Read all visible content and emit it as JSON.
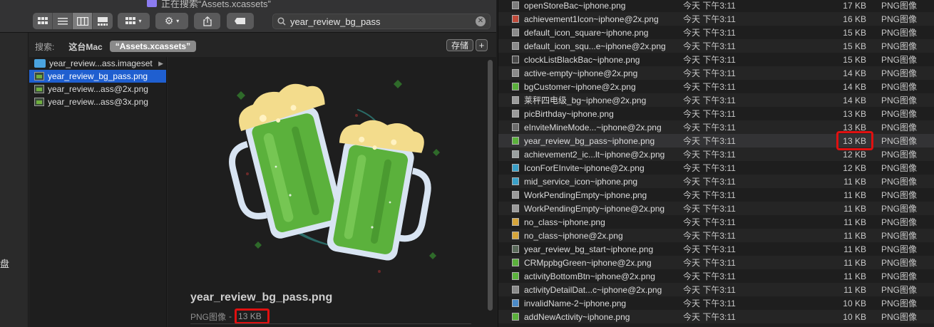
{
  "window_title": "正在搜索“Assets.xcassets”",
  "sidebar_partial_char": "盘",
  "search": {
    "value": "year_review_bg_pass"
  },
  "scope": {
    "label": "搜索:",
    "this_mac": "这台Mac",
    "folder": "“Assets.xcassets”",
    "save": "存储",
    "add": "+"
  },
  "results": [
    {
      "name": "year_review...ass.imageset",
      "type": "folder"
    },
    {
      "name": "year_review_bg_pass.png",
      "type": "file",
      "selected": true
    },
    {
      "name": "year_review...ass@2x.png",
      "type": "file"
    },
    {
      "name": "year_review...ass@3x.png",
      "type": "file"
    }
  ],
  "preview": {
    "filename": "year_review_bg_pass.png",
    "kind": "PNG图像",
    "separator": "-",
    "size": "13 KB"
  },
  "list": [
    {
      "name": "openStoreBac~iphone.png",
      "date": "今天 下午3:11",
      "size": "17 KB",
      "kind": "PNG图像"
    },
    {
      "name": "achievement1Icon~iphone@2x.png",
      "date": "今天 下午3:11",
      "size": "16 KB",
      "kind": "PNG图像"
    },
    {
      "name": "default_icon_square~iphone.png",
      "date": "今天 下午3:11",
      "size": "15 KB",
      "kind": "PNG图像"
    },
    {
      "name": "default_icon_squ...e~iphone@2x.png",
      "date": "今天 下午3:11",
      "size": "15 KB",
      "kind": "PNG图像"
    },
    {
      "name": "clockListBlackBac~iphone.png",
      "date": "今天 下午3:11",
      "size": "15 KB",
      "kind": "PNG图像"
    },
    {
      "name": "active-empty~iphone@2x.png",
      "date": "今天 下午3:11",
      "size": "14 KB",
      "kind": "PNG图像"
    },
    {
      "name": "bgCustomer~iphone@2x.png",
      "date": "今天 下午3:11",
      "size": "14 KB",
      "kind": "PNG图像"
    },
    {
      "name": "莱秤四电级_bg~iphone@2x.png",
      "date": "今天 下午3:11",
      "size": "14 KB",
      "kind": "PNG图像"
    },
    {
      "name": "picBirthday~iphone.png",
      "date": "今天 下午3:11",
      "size": "13 KB",
      "kind": "PNG图像"
    },
    {
      "name": "eInviteMineMode...~iphone@2x.png",
      "date": "今天 下午3:11",
      "size": "13 KB",
      "kind": "PNG图像"
    },
    {
      "name": "year_review_bg_pass~iphone.png",
      "date": "今天 下午3:11",
      "size": "13 KB",
      "kind": "PNG图像",
      "highlight": true
    },
    {
      "name": "achievement2_ic...lt~iphone@2x.png",
      "date": "今天 下午3:11",
      "size": "12 KB",
      "kind": "PNG图像"
    },
    {
      "name": "IconForEInvite~iphone@2x.png",
      "date": "今天 下午3:11",
      "size": "12 KB",
      "kind": "PNG图像"
    },
    {
      "name": "mid_service_icon~iphone.png",
      "date": "今天 下午3:11",
      "size": "11 KB",
      "kind": "PNG图像"
    },
    {
      "name": "WorkPendingEmpty~iphone.png",
      "date": "今天 下午3:11",
      "size": "11 KB",
      "kind": "PNG图像"
    },
    {
      "name": "WorkPendingEmpty~iphone@2x.png",
      "date": "今天 下午3:11",
      "size": "11 KB",
      "kind": "PNG图像"
    },
    {
      "name": "no_class~iphone.png",
      "date": "今天 下午3:11",
      "size": "11 KB",
      "kind": "PNG图像"
    },
    {
      "name": "no_class~iphone@2x.png",
      "date": "今天 下午3:11",
      "size": "11 KB",
      "kind": "PNG图像"
    },
    {
      "name": "year_review_bg_start~iphone.png",
      "date": "今天 下午3:11",
      "size": "11 KB",
      "kind": "PNG图像"
    },
    {
      "name": "CRMppbgGreen~iphone@2x.png",
      "date": "今天 下午3:11",
      "size": "11 KB",
      "kind": "PNG图像"
    },
    {
      "name": "activityBottomBtn~iphone@2x.png",
      "date": "今天 下午3:11",
      "size": "11 KB",
      "kind": "PNG图像"
    },
    {
      "name": "activityDetailDat...c~iphone@2x.png",
      "date": "今天 下午3:11",
      "size": "11 KB",
      "kind": "PNG图像"
    },
    {
      "name": "invalidName-2~iphone.png",
      "date": "今天 下午3:11",
      "size": "10 KB",
      "kind": "PNG图像"
    },
    {
      "name": "addNewActivity~iphone.png",
      "date": "今天 下午3:11",
      "size": "10 KB",
      "kind": "PNG图像"
    }
  ],
  "colors": {
    "selection": "#1f5fd0",
    "annotation_red": "#e01010",
    "beer_green": "#5bb13c",
    "foam": "#f3dc8c"
  }
}
